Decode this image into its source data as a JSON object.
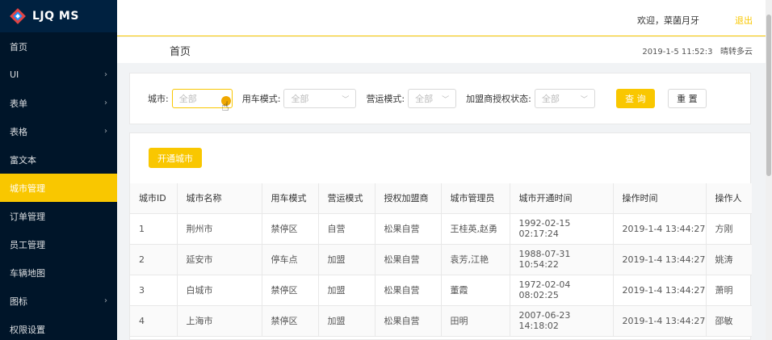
{
  "app": {
    "logo_text": "LJQ MS"
  },
  "sidebar": {
    "items": [
      {
        "label": "首页",
        "arrow": ""
      },
      {
        "label": "UI",
        "arrow": "›"
      },
      {
        "label": "表单",
        "arrow": "›"
      },
      {
        "label": "表格",
        "arrow": "›"
      },
      {
        "label": "富文本",
        "arrow": ""
      },
      {
        "label": "城市管理",
        "arrow": ""
      },
      {
        "label": "订单管理",
        "arrow": ""
      },
      {
        "label": "员工管理",
        "arrow": ""
      },
      {
        "label": "车辆地图",
        "arrow": ""
      },
      {
        "label": "图标",
        "arrow": "›"
      },
      {
        "label": "权限设置",
        "arrow": ""
      }
    ],
    "active_index": 5
  },
  "header": {
    "welcome": "欢迎，菜菌月牙",
    "logout": "退出"
  },
  "breadcrumb": {
    "title": "首页",
    "datetime": "2019-1-5 11:52:3",
    "weather": "晴转多云"
  },
  "filters": {
    "city": {
      "label": "城市:",
      "value": "全部"
    },
    "car_mode": {
      "label": "用车模式:",
      "value": "全部"
    },
    "op_mode": {
      "label": "营运模式:",
      "value": "全部"
    },
    "auth_status": {
      "label": "加盟商授权状态:",
      "value": "全部"
    },
    "query_label": "查 询",
    "reset_label": "重 置"
  },
  "table": {
    "open_city_label": "开通城市",
    "columns": [
      "城市ID",
      "城市名称",
      "用车模式",
      "营运模式",
      "授权加盟商",
      "城市管理员",
      "城市开通时间",
      "操作时间",
      "操作人"
    ],
    "rows": [
      [
        "1",
        "荆州市",
        "禁停区",
        "自营",
        "松果自营",
        "王桂英,赵勇",
        "1992-02-15 02:17:24",
        "2019-1-4 13:44:27",
        "方刚"
      ],
      [
        "2",
        "延安市",
        "停车点",
        "加盟",
        "松果自营",
        "袁芳,江艳",
        "1988-07-31 10:54:22",
        "2019-1-4 13:44:27",
        "姚涛"
      ],
      [
        "3",
        "白城市",
        "禁停区",
        "加盟",
        "松果自营",
        "董霞",
        "1972-02-04 08:02:25",
        "2019-1-4 13:44:27",
        "萧明"
      ],
      [
        "4",
        "上海市",
        "禁停区",
        "加盟",
        "松果自营",
        "田明",
        "2007-06-23 14:18:02",
        "2019-1-4 13:44:27",
        "邵敏"
      ]
    ]
  },
  "colors": {
    "accent": "#f9c700",
    "sidebar_bg": "#001529"
  }
}
